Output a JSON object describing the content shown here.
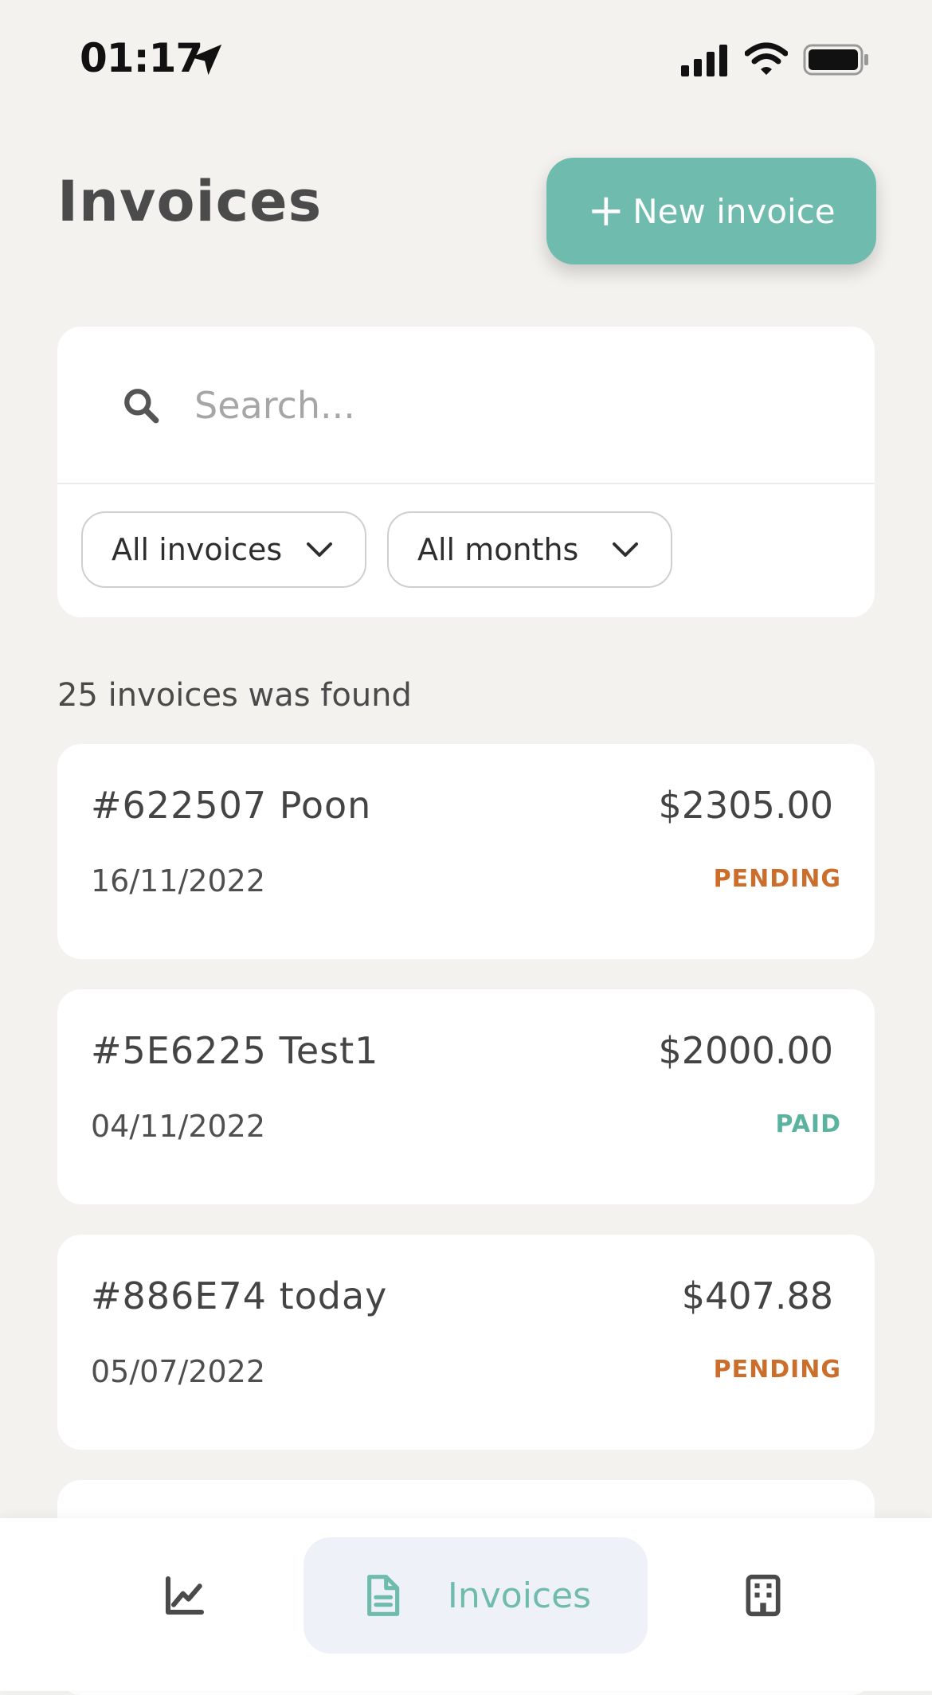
{
  "status_bar": {
    "time": "01:17"
  },
  "header": {
    "title": "Invoices",
    "new_invoice_plus": "+",
    "new_invoice_label": "New invoice"
  },
  "search": {
    "placeholder": "Search...",
    "value": ""
  },
  "filters": {
    "type_selected": "All invoices",
    "month_selected": "All months"
  },
  "results": {
    "count_text": "25 invoices was found"
  },
  "invoices": [
    {
      "id_title": "#622507  Poon",
      "amount": "$2305.00",
      "date": "16/11/2022",
      "status": "PENDING"
    },
    {
      "id_title": "#5E6225  Test1",
      "amount": "$2000.00",
      "date": "04/11/2022",
      "status": "PAID"
    },
    {
      "id_title": "#886E74  today",
      "amount": "$407.88",
      "date": "05/07/2022",
      "status": "PENDING"
    }
  ],
  "nav": {
    "active_label": "Invoices",
    "icons": [
      "chart-line-icon",
      "document-icon",
      "building-icon"
    ]
  },
  "colors": {
    "accent": "#6fbcae",
    "pending": "#cc6e2b",
    "paid": "#5ab39e",
    "background": "#f3f2ef"
  }
}
